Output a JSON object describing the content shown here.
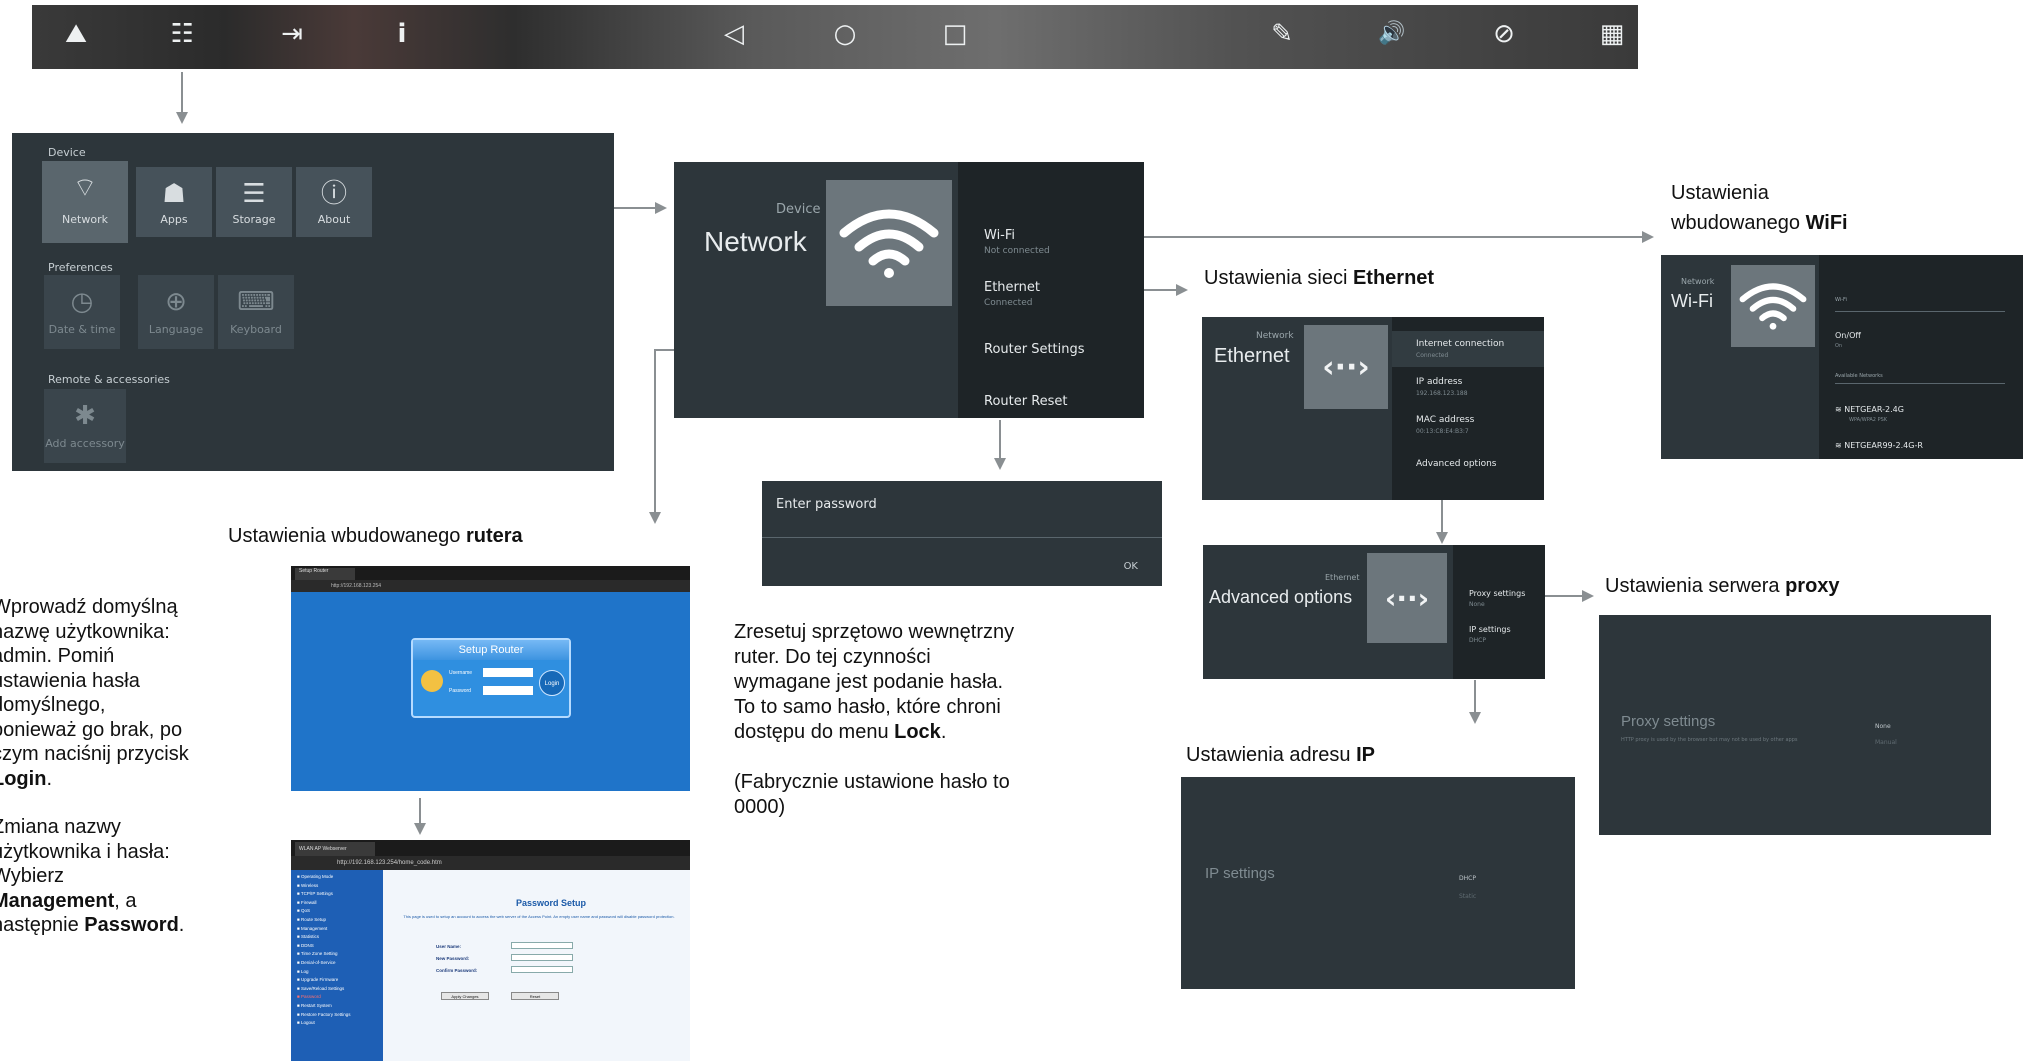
{
  "toolbar": {
    "buttons": [
      {
        "name": "screen-mode-icon",
        "glyph": "⛰"
      },
      {
        "name": "settings-sliders-icon",
        "glyph": "☷"
      },
      {
        "name": "input-source-icon",
        "glyph": "⇥"
      },
      {
        "name": "info-icon",
        "glyph": "i"
      },
      {
        "name": "back-icon",
        "glyph": "◁"
      },
      {
        "name": "home-icon",
        "glyph": "○"
      },
      {
        "name": "recents-icon",
        "glyph": "□"
      },
      {
        "name": "pen-icon",
        "glyph": "✎"
      },
      {
        "name": "volume-icon",
        "glyph": "🔊"
      },
      {
        "name": "eye-off-icon",
        "glyph": "⊘"
      },
      {
        "name": "apps-grid-icon",
        "glyph": "▦"
      }
    ]
  },
  "device_settings": {
    "section_device": "Device",
    "section_preferences": "Preferences",
    "section_remote": "Remote & accessories",
    "tiles_device": [
      {
        "label": "Network",
        "icon": "⌔"
      },
      {
        "label": "Apps",
        "icon": "☗"
      },
      {
        "label": "Storage",
        "icon": "☰"
      },
      {
        "label": "About",
        "icon": "ⓘ"
      }
    ],
    "tiles_preferences": [
      {
        "label": "Date & time",
        "icon": "◷"
      },
      {
        "label": "Language",
        "icon": "⊕"
      },
      {
        "label": "Keyboard",
        "icon": "⌨"
      }
    ],
    "tiles_remote": [
      {
        "label": "Add accessory",
        "icon": "✱"
      }
    ]
  },
  "network_panel": {
    "kicker": "Device",
    "title": "Network",
    "items": [
      {
        "label": "Wi-Fi",
        "sub": "Not connected"
      },
      {
        "label": "Ethernet",
        "sub": "Connected"
      },
      {
        "label": "Router Settings",
        "sub": ""
      },
      {
        "label": "Router Reset",
        "sub": ""
      }
    ]
  },
  "password_dialog": {
    "label": "Enter password",
    "ok": "OK"
  },
  "reset_text": {
    "line1": "Zresetuj sprzętowo wewnętrzny",
    "line2": "ruter. Do tej czynności",
    "line3": "wymagane jest podanie hasła.",
    "line4": "To to samo hasło, które chroni",
    "line5_pre": "dostępu do menu ",
    "line5_bold": "Lock",
    "line5_post": ".",
    "factory1": "(Fabrycznie ustawione hasło to",
    "factory2": "0000)"
  },
  "ethernet_caption": {
    "pre": "Ustawienia sieci ",
    "bold": "Ethernet"
  },
  "ethernet_panel": {
    "kicker": "Network",
    "title": "Ethernet",
    "items": [
      {
        "label": "Internet connection",
        "sub": "Connected"
      },
      {
        "label": "IP address",
        "sub": "192.168.123.188"
      },
      {
        "label": "MAC address",
        "sub": "00:13:C8:E4:B3:7"
      },
      {
        "label": "Advanced options",
        "sub": ""
      }
    ]
  },
  "advanced_panel": {
    "kicker": "Ethernet",
    "title": "Advanced options",
    "items": [
      {
        "label": "Proxy settings",
        "sub": "None"
      },
      {
        "label": "IP settings",
        "sub": "DHCP"
      }
    ]
  },
  "wifi_caption": {
    "line1": "Ustawienia",
    "pre": "wbudowanego ",
    "bold": "WiFi"
  },
  "wifi_panel": {
    "kicker": "Network",
    "title": "Wi-Fi",
    "field_top": "Wi-Fi",
    "onoff": "On/Off",
    "onoff_sub": "On",
    "available": "Available Networks",
    "networks": [
      {
        "name": "NETGEAR-2.4G",
        "sub": "WPA/WPA2 PSK"
      },
      {
        "name": "NETGEAR99-2.4G-R",
        "sub": ""
      }
    ]
  },
  "proxy_caption": {
    "pre": "Ustawienia serwera ",
    "bold": "proxy"
  },
  "proxy_panel": {
    "title": "Proxy settings",
    "desc": "HTTP proxy is used by the browser but may not be used by other apps",
    "opt1": "None",
    "opt2": "Manual"
  },
  "ip_caption": {
    "pre": "Ustawienia adresu ",
    "bold": "IP"
  },
  "ip_panel": {
    "title": "IP settings",
    "opt1": "DHCP",
    "opt2": "Static"
  },
  "router_caption": {
    "pre": "Ustawienia wbudowanego ",
    "bold": "rutera"
  },
  "router_left_text": {
    "l1": "Wprowadź domyślną",
    "l2": "nazwę użytkownika:",
    "l3": "admin. Pomiń",
    "l4": "ustawienia hasła",
    "l5": "domyślnego,",
    "l6": "ponieważ go brak, po",
    "l7": "czym naciśnij przycisk",
    "l8": "Login",
    "l8_post": ".",
    "m1": "Zmiana nazwy",
    "m2": "użytkownika i hasła:",
    "m3": "Wybierz",
    "m4": "Management",
    "m4_post": ", a",
    "m5_pre": "następnie ",
    "m5_bold": "Password",
    "m5_post": "."
  },
  "router_screen1": {
    "tab": "Setup Router",
    "url": "http://192.168.123.254",
    "box_title": "Setup Router",
    "username_label": "Username",
    "password_label": "Password",
    "login": "Login"
  },
  "router_screen2": {
    "tab": "WLAN AP Webserver",
    "url": "http://192.168.123.254/home_code.htm",
    "heading": "Password Setup",
    "desc": "This page is used to setup an account to access the web server of the Access Point. An empty user name and password will disable password protection.",
    "user_name": "User Name:",
    "new_password": "New Password:",
    "confirm_password": "Confirm Password:",
    "apply": "Apply Changes",
    "reset": "Reset",
    "menu": [
      "Operating Mode",
      "Wireless",
      "TCP/IP Settings",
      "Firewall",
      "QoS",
      "Route Setup",
      "Management",
      "Statistics",
      "DDNS",
      "Time Zone Setting",
      "Denial-of-Service",
      "Log",
      "Upgrade Firmware",
      "Save/Reload Settings",
      "Password",
      "Restart System",
      "Restore Factory Settings",
      "Logout"
    ]
  },
  "colors": {
    "panel": "#2d363b",
    "accent_blue": "#1f74c9",
    "arrow": "#8a8f92"
  }
}
